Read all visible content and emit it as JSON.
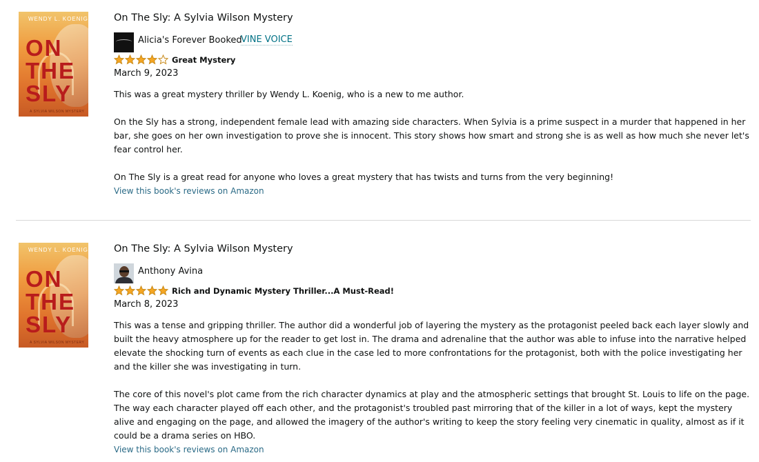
{
  "reviews": [
    {
      "book_title": "On The Sly: A Sylvia Wilson Mystery",
      "cover": {
        "author_text": "WENDY L. KOENIG",
        "title_lines": [
          "ON",
          "THE",
          "SLY"
        ],
        "series_text": "A SYLVIA WILSON MYSTERY"
      },
      "reviewer": "Alicia's Forever Booked",
      "badge": "VINE VOICE",
      "rating": 4,
      "headline": "Great Mystery",
      "date": "March 9, 2023",
      "paragraphs": [
        "This was a great mystery thriller by Wendy L. Koenig, who is a new to me author.",
        "On the Sly has a strong, independent female lead with amazing side characters. When Sylvia is a prime suspect in a murder that happened in her bar, she goes on her own investigation to prove she is innocent. This story shows how smart and strong she is as well as how much she never let's fear control her.",
        "On The Sly is a great read for anyone who loves a great mystery that has twists and turns from the very beginning!"
      ],
      "link": "View this book's reviews on Amazon"
    },
    {
      "book_title": "On The Sly: A Sylvia Wilson Mystery",
      "cover": {
        "author_text": "WENDY L. KOENIG",
        "title_lines": [
          "ON",
          "THE",
          "SLY"
        ],
        "series_text": "A SYLVIA WILSON MYSTERY"
      },
      "reviewer": "Anthony Avina",
      "rating": 5,
      "headline": "Rich and Dynamic Mystery Thriller...A Must-Read!",
      "date": "March 8, 2023",
      "paragraphs": [
        "This was a tense and gripping thriller. The author did a wonderful job of layering the mystery as the protagonist peeled back each layer slowly and built the heavy atmosphere up for the reader to get lost in. The drama and adrenaline that the author was able to infuse into the narrative helped elevate the shocking turn of events as each clue in the case led to more confrontations for the protagonist, both with the police investigating her and the killer she was investigating in turn.",
        "The core of this novel's plot came from the rich character dynamics at play and the atmospheric settings that brought St. Louis to life on the page. The way each character played off each other, and the protagonist's troubled past mirroring that of the killer in a lot of ways, kept the mystery alive and engaging on the page, and allowed the imagery of the author's writing to keep the story feeling very cinematic in quality, almost as if it could be a drama series on HBO."
      ],
      "link": "View this book's reviews on Amazon"
    }
  ],
  "colors": {
    "link": "#2a6a86",
    "vine": "#007185",
    "star": "#f5a623",
    "star_outline": "#c88a1a",
    "title_red": "#b81c1c"
  }
}
